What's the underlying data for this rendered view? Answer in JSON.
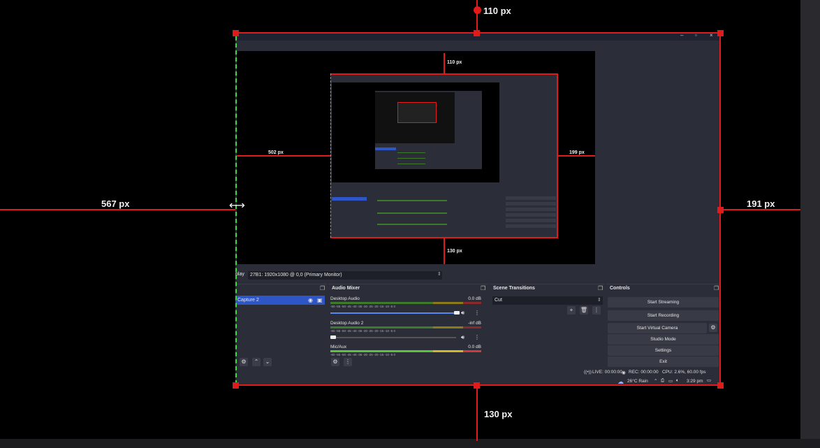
{
  "measurements": {
    "top": "110 px",
    "left": "567 px",
    "right": "191 px",
    "bottom": "130 px",
    "nested_top": "110 px",
    "nested_left": "502 px",
    "nested_right": "199 px",
    "nested_bottom": "130 px"
  },
  "window_controls": {
    "minimize": "–",
    "maximize": "▫",
    "close": "×"
  },
  "display_row": {
    "label": "play",
    "value": "27B1: 1920x1080 @ 0,0 (Primary Monitor)"
  },
  "scenes": {
    "selected_item": "Capture 2"
  },
  "audio_mixer": {
    "title": "Audio Mixer",
    "ticks": "-60 -55 -50 -45 -40 -35 -30 -25 -20 -15 -10 -5 0",
    "channels": [
      {
        "name": "Desktop Audio",
        "db": "0.0 dB"
      },
      {
        "name": "Desktop Audio 2",
        "db": "-inf dB"
      },
      {
        "name": "Mic/Aux",
        "db": "0.0 dB"
      }
    ]
  },
  "scene_transitions": {
    "title": "Scene Transitions",
    "selected": "Cut"
  },
  "controls": {
    "title": "Controls",
    "buttons": [
      "Start Streaming",
      "Start Recording",
      "Start Virtual Camera",
      "Studio Mode",
      "Settings",
      "Exit"
    ]
  },
  "status_bar": {
    "live": "LIVE: 00:00:00",
    "rec": "REC: 00:00:00",
    "cpu": "CPU: 2.6%, 60.00 fps"
  },
  "taskbar": {
    "weather": "26°C  Rain",
    "time": "3:29 pm"
  },
  "colors": {
    "accent_red": "#e01b1b",
    "guide_green": "#3bdc42",
    "selection_blue": "#2f56c7",
    "panel_bg": "#2b2e38"
  }
}
